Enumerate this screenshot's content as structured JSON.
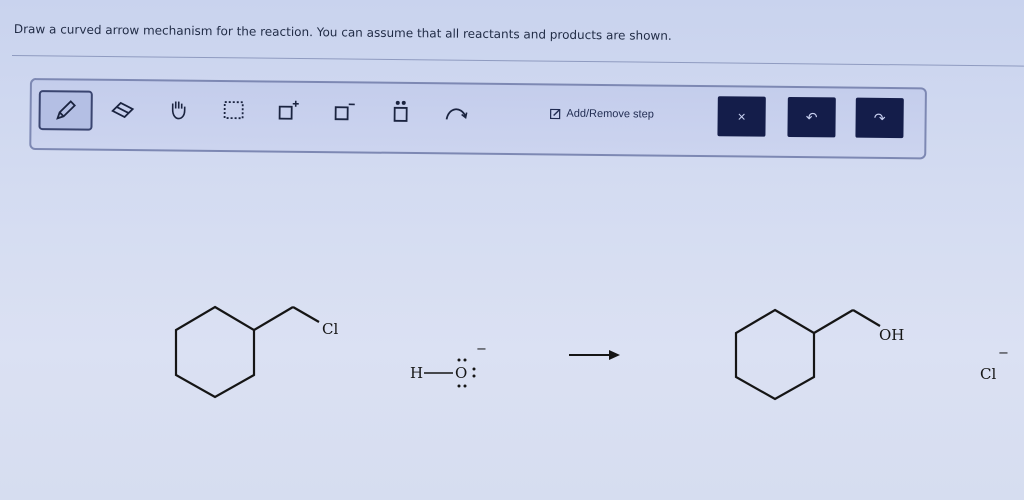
{
  "question": "Draw a curved arrow mechanism for the reaction. You can assume that all reactants and products are shown.",
  "toolbar": {
    "tools": [
      {
        "name": "pencil-tool",
        "icon": "pencil-icon"
      },
      {
        "name": "eraser-tool",
        "icon": "eraser-icon"
      },
      {
        "name": "hand-tool",
        "icon": "hand-icon"
      },
      {
        "name": "select-box-tool",
        "icon": "dotted-box-icon"
      },
      {
        "name": "add-positive-charge-tool",
        "icon": "positive-charge-icon"
      },
      {
        "name": "add-negative-charge-tool",
        "icon": "negative-charge-icon"
      },
      {
        "name": "lone-pair-tool",
        "icon": "lone-pair-icon"
      },
      {
        "name": "curved-arrow-tool",
        "icon": "curved-arrow-icon"
      }
    ],
    "add_remove_step": "Add/Remove step",
    "clear_symbol": "×",
    "undo_symbol": "↶",
    "redo_symbol": "↷"
  },
  "scheme": {
    "reactant1_substituent": "Cl",
    "hydroxide_h": "H",
    "hydroxide_o": "O",
    "hydroxide_charge": "−",
    "product_substituent": "OH",
    "chloride": "Cl",
    "chloride_charge": "−"
  },
  "colors": {
    "toolbar_dark_button": "#141d4a",
    "background": "#d3dbf1"
  }
}
